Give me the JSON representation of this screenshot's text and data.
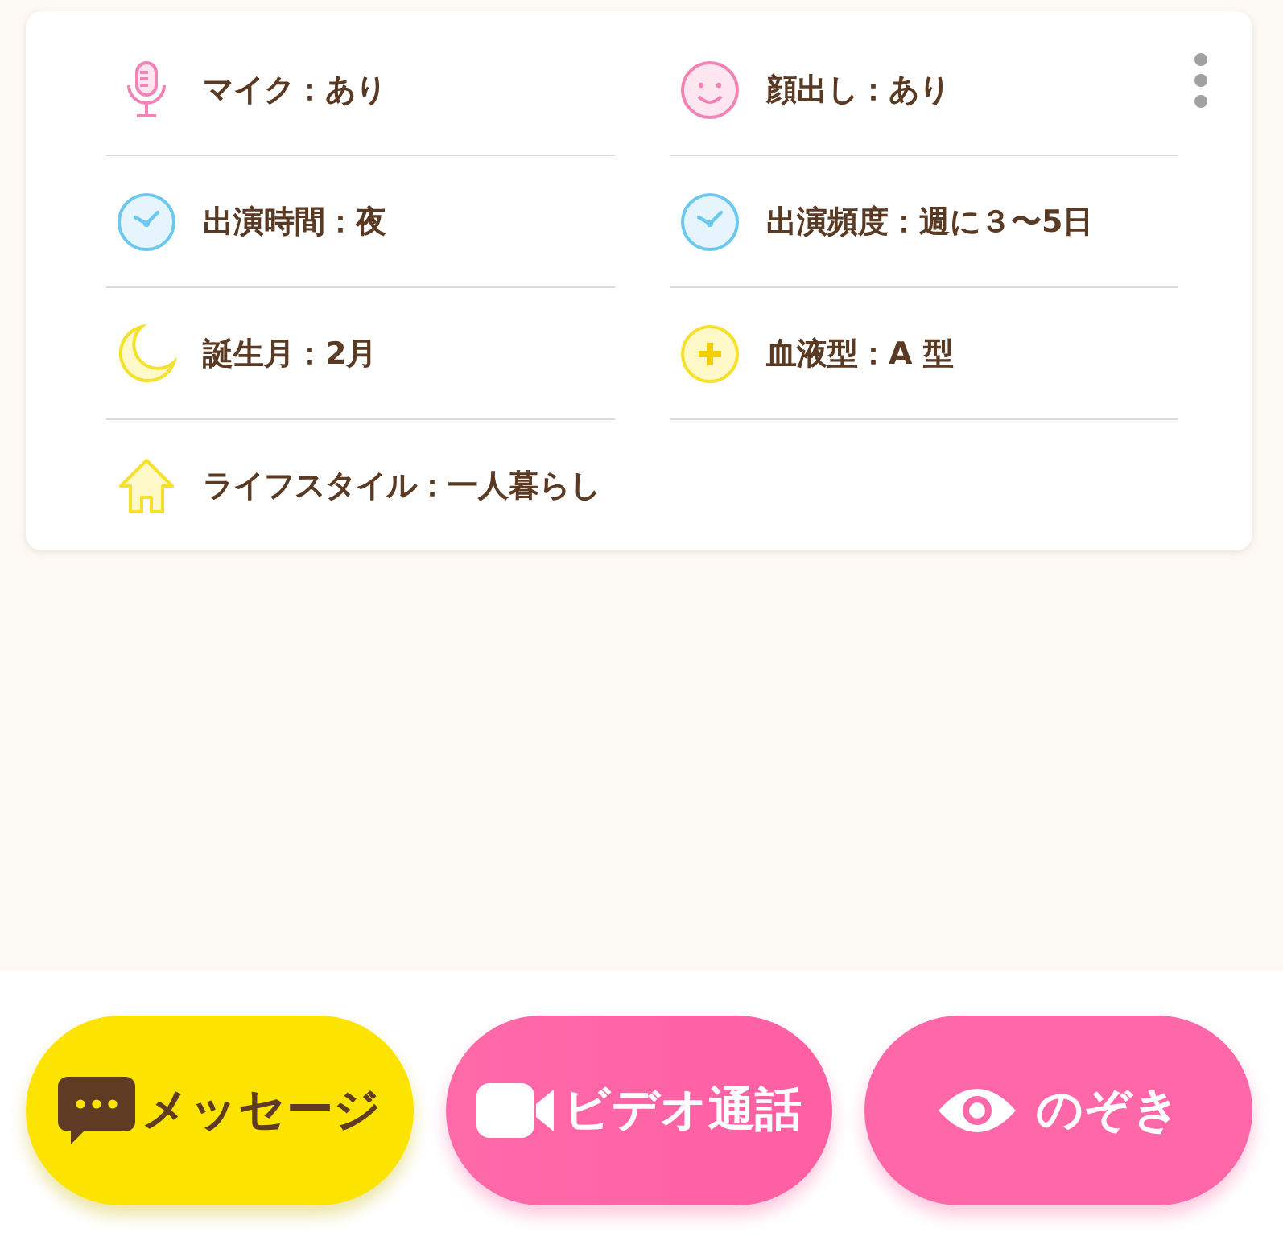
{
  "profile": {
    "items": [
      {
        "kind": "mic",
        "text": "マイク：あり"
      },
      {
        "kind": "face",
        "text": "顔出し：あり"
      },
      {
        "kind": "clock",
        "text": "出演時間：夜"
      },
      {
        "kind": "clock",
        "text": "出演頻度：週に３〜5日"
      },
      {
        "kind": "moon",
        "text": "誕生月：2月"
      },
      {
        "kind": "plus",
        "text": "血液型：A 型"
      },
      {
        "kind": "house",
        "text": "ライフスタイル：一人暮らし"
      }
    ]
  },
  "actions": [
    {
      "kind": "message",
      "label": "メッセージ"
    },
    {
      "kind": "video",
      "label": "ビデオ通話"
    },
    {
      "kind": "peek",
      "label": "のぞき"
    }
  ]
}
